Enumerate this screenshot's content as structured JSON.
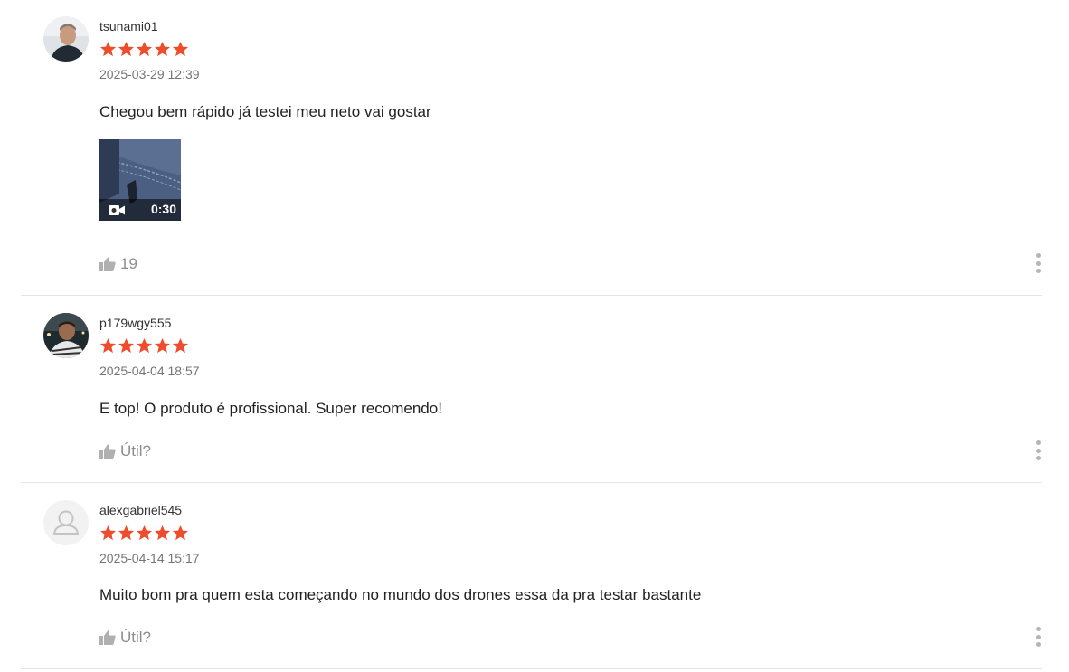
{
  "reviews": [
    {
      "username": "tsunami01",
      "rating": 5,
      "date": "2025-03-29 12:39",
      "comment": "Chegou bem rápido já testei meu neto vai gostar",
      "media": {
        "type": "video",
        "duration": "0:30"
      },
      "like_label": "19"
    },
    {
      "username": "p179wgy555",
      "rating": 5,
      "date": "2025-04-04 18:57",
      "comment": "E top! O produto é profissional. Super recomendo!",
      "like_label": "Útil?"
    },
    {
      "username": "alexgabriel545",
      "rating": 5,
      "date": "2025-04-14 15:17",
      "comment": "Muito bom pra quem esta começando no mundo dos drones essa da pra testar bastante",
      "like_label": "Útil?"
    }
  ],
  "colors": {
    "star": "#ee4d2d",
    "muted": "#8d8d8d",
    "divider": "#e5e5e5"
  },
  "icons": [
    "star-icon",
    "video-camera-icon",
    "thumbs-up-icon",
    "more-vertical-icon",
    "default-avatar-icon"
  ]
}
